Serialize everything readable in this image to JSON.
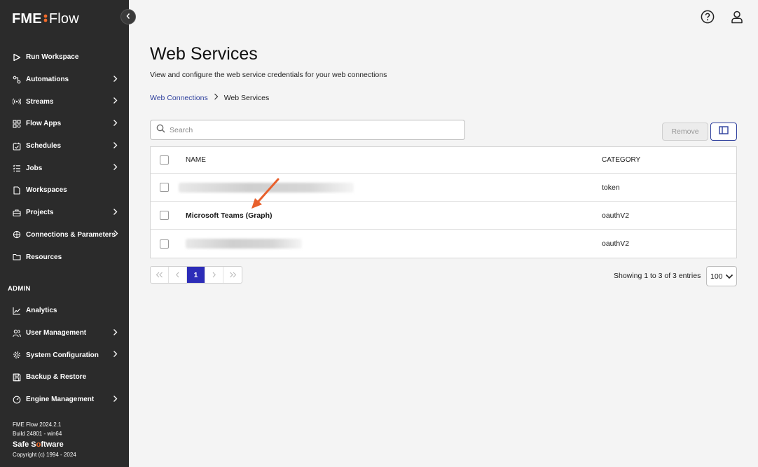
{
  "app": {
    "logo_prefix": "FME",
    "logo_suffix": "Flow"
  },
  "sidebar": {
    "items": [
      {
        "label": "Run Workspace",
        "icon": "play-icon",
        "chevron": false
      },
      {
        "label": "Automations",
        "icon": "automations-icon",
        "chevron": true
      },
      {
        "label": "Streams",
        "icon": "streams-icon",
        "chevron": true
      },
      {
        "label": "Flow Apps",
        "icon": "flow-apps-icon",
        "chevron": true
      },
      {
        "label": "Schedules",
        "icon": "calendar-icon",
        "chevron": true
      },
      {
        "label": "Jobs",
        "icon": "jobs-icon",
        "chevron": true
      },
      {
        "label": "Workspaces",
        "icon": "document-icon",
        "chevron": false
      },
      {
        "label": "Projects",
        "icon": "briefcase-icon",
        "chevron": true
      },
      {
        "label": "Connections & Parameters",
        "icon": "connections-icon",
        "chevron": true
      },
      {
        "label": "Resources",
        "icon": "folder-icon",
        "chevron": false
      }
    ],
    "admin_label": "ADMIN",
    "admin_items": [
      {
        "label": "Analytics",
        "icon": "analytics-icon",
        "chevron": false
      },
      {
        "label": "User Management",
        "icon": "users-icon",
        "chevron": true
      },
      {
        "label": "System Configuration",
        "icon": "gear-icon",
        "chevron": true
      },
      {
        "label": "Backup & Restore",
        "icon": "save-icon",
        "chevron": false
      },
      {
        "label": "Engine Management",
        "icon": "gauge-icon",
        "chevron": true
      }
    ],
    "footer": {
      "version": "FME Flow 2024.2.1",
      "build": "Build 24801 - win64",
      "company_a": "Safe S",
      "company_o": "o",
      "company_b": "ftware",
      "copyright": "Copyright (c) 1994 - 2024"
    }
  },
  "header": {
    "help_icon": "help-icon",
    "user_icon": "user-icon"
  },
  "main": {
    "title": "Web Services",
    "subtitle": "View and configure the web service credentials for your web connections",
    "breadcrumb": {
      "parent": "Web Connections",
      "current": "Web Services"
    },
    "search": {
      "placeholder": "Search",
      "value": ""
    },
    "remove_label": "Remove",
    "table": {
      "headers": {
        "name": "NAME",
        "category": "CATEGORY"
      },
      "rows": [
        {
          "name": "",
          "category": "token",
          "redacted": true
        },
        {
          "name": "Microsoft Teams (Graph)",
          "category": "oauthV2",
          "redacted": false
        },
        {
          "name": "",
          "category": "oauthV2",
          "redacted": true
        }
      ]
    },
    "pagination": {
      "current_page": "1",
      "showing": "Showing 1 to 3 of 3 entries",
      "per_page": "100"
    }
  },
  "colors": {
    "accent": "#2c3e9c",
    "brand_orange": "#f26b2a",
    "sidebar_bg": "#2b2b2b",
    "annotation_arrow": "#e8602c"
  }
}
